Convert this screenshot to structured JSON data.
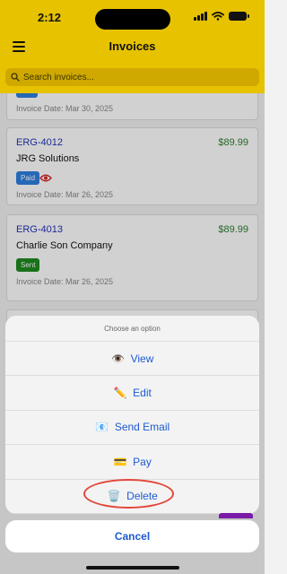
{
  "status_bar": {
    "time": "2:12"
  },
  "header": {
    "title": "Invoices"
  },
  "search": {
    "placeholder": "Search invoices..."
  },
  "invoices": [
    {
      "number": "",
      "customer": "",
      "amount": "",
      "status": "",
      "date_label": "Invoice Date: Mar 30, 2025"
    },
    {
      "number": "ERG-4012",
      "customer": "JRG Solutions",
      "amount": "$89.99",
      "status": "Paid",
      "viewed": true,
      "date_label": "Invoice Date: Mar 26, 2025"
    },
    {
      "number": "ERG-4013",
      "customer": "Charlie Son Company",
      "amount": "$89.99",
      "status": "Sent",
      "date_label": "Invoice Date: Mar 26, 2025"
    }
  ],
  "action_sheet": {
    "title": "Choose an option",
    "options": [
      {
        "icon": "👁️",
        "icon_name": "eye-icon",
        "label": "View"
      },
      {
        "icon": "✏️",
        "icon_name": "pencil-icon",
        "label": "Edit"
      },
      {
        "icon": "📧",
        "icon_name": "email-icon",
        "label": "Send Email"
      },
      {
        "icon": "💳",
        "icon_name": "credit-card-icon",
        "label": "Pay"
      },
      {
        "icon": "🗑️",
        "icon_name": "trash-icon",
        "label": "Delete"
      }
    ],
    "cancel_label": "Cancel"
  },
  "colors": {
    "header": "#e6c200",
    "link_blue": "#2333b8",
    "amount_green": "#2e7d32",
    "paid_badge": "#2f7fe0",
    "sent_badge": "#1f8a1f",
    "action_blue": "#1e5ad0",
    "annotation_red": "#e2473a"
  }
}
